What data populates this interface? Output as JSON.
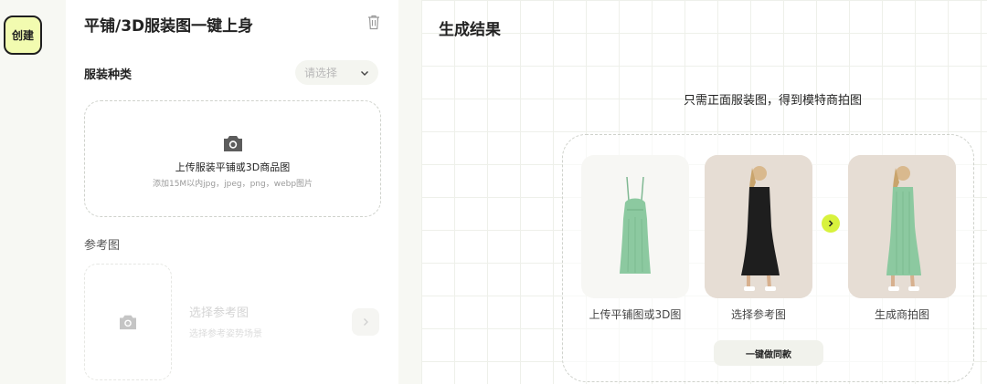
{
  "create_label": "创建",
  "left": {
    "title": "平铺/3D服装图一键上身",
    "category_label": "服装种类",
    "category_placeholder": "请选择",
    "upload_title": "上传服装平铺或3D商品图",
    "upload_hint": "添加15M以内jpg，jpeg，png，webp图片",
    "ref_label": "参考图",
    "ref_title": "选择参考图",
    "ref_hint": "选择参考姿势场景"
  },
  "right": {
    "title": "生成结果",
    "subtitle": "只需正面服装图，得到模特商拍图",
    "step1": "上传平铺图或3D图",
    "step2": "选择参考图",
    "step3": "生成商拍图",
    "action": "一键做同款"
  },
  "colors": {
    "accent": "#d8f23d",
    "create_bg": "#f2fbb0",
    "dress": "#8cc9a0"
  }
}
